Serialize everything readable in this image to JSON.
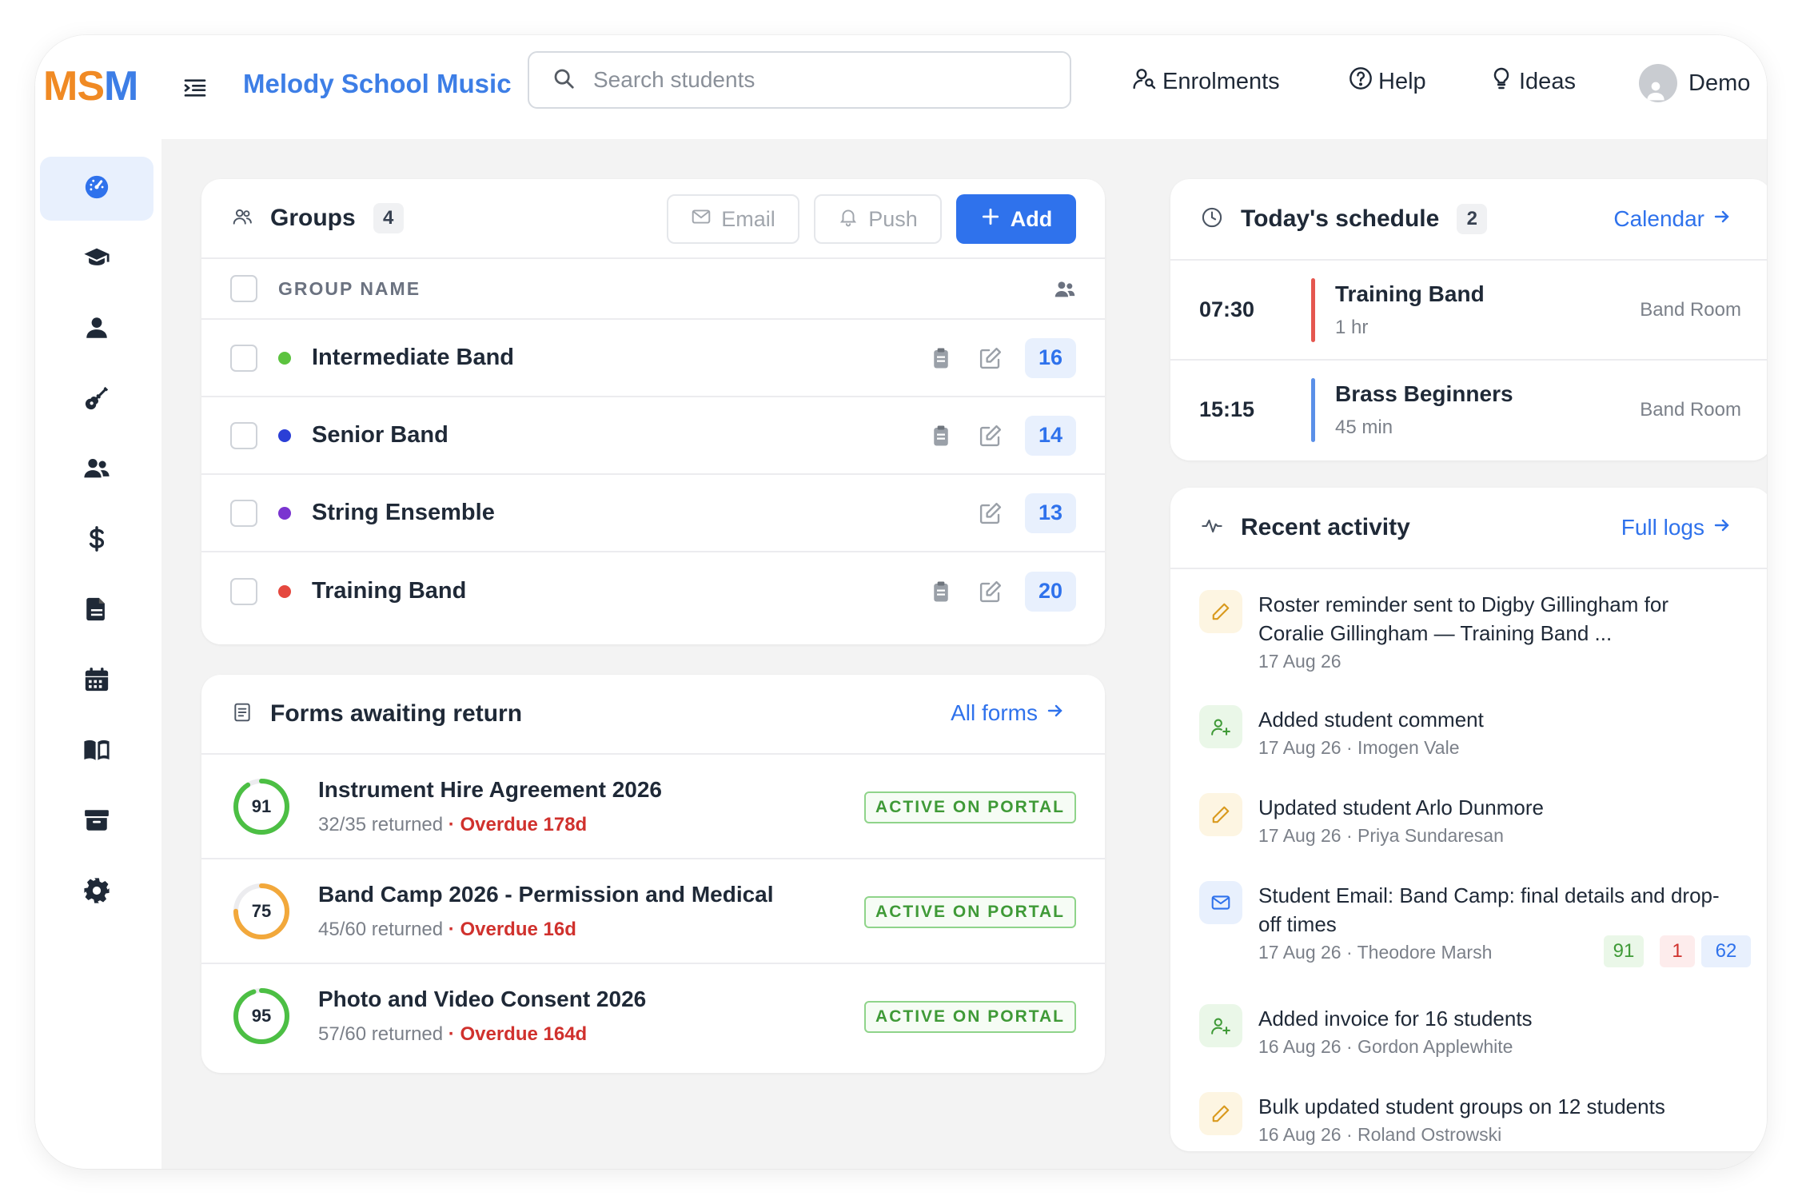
{
  "app": {
    "logo": {
      "m1": "M",
      "s": "S",
      "m2": "M"
    },
    "brand": "Melody School Music",
    "search_placeholder": "Search students",
    "nav": {
      "enrolments": "Enrolments",
      "help": "Help",
      "ideas": "Ideas",
      "user": "Demo"
    }
  },
  "sidebar": {
    "items": [
      {
        "icon": "dashboard-icon",
        "active": true
      },
      {
        "icon": "graduation-cap-icon"
      },
      {
        "icon": "user-icon"
      },
      {
        "icon": "guitar-icon"
      },
      {
        "icon": "users-icon"
      },
      {
        "icon": "dollar-icon"
      },
      {
        "icon": "file-icon"
      },
      {
        "icon": "calendar-icon"
      },
      {
        "icon": "book-icon"
      },
      {
        "icon": "archive-icon"
      },
      {
        "icon": "gear-icon"
      }
    ]
  },
  "groups": {
    "title": "Groups",
    "count": "4",
    "email_label": "Email",
    "push_label": "Push",
    "add_label": "Add",
    "column_header": "GROUP NAME",
    "rows": [
      {
        "name": "Intermediate Band",
        "color": "#5cc33f",
        "count": "16",
        "has_clipboard": true
      },
      {
        "name": "Senior Band",
        "color": "#2b3fd6",
        "count": "14",
        "has_clipboard": true
      },
      {
        "name": "String Ensemble",
        "color": "#7a34d0",
        "count": "13",
        "has_clipboard": false
      },
      {
        "name": "Training Band",
        "color": "#e5483f",
        "count": "20",
        "has_clipboard": true
      }
    ]
  },
  "forms": {
    "title": "Forms awaiting return",
    "link": "All forms",
    "rows": [
      {
        "score": "91",
        "progress": 0.91,
        "ring_color": "#4cbf44",
        "title": "Instrument Hire Agreement 2026",
        "returned": "32/35 returned",
        "overdue": "· Overdue 178d",
        "status": "ACTIVE ON PORTAL"
      },
      {
        "score": "75",
        "progress": 0.75,
        "ring_color": "#f2a83b",
        "title": "Band Camp 2026 - Permission and Medical",
        "returned": "45/60 returned",
        "overdue": "· Overdue 16d",
        "status": "ACTIVE ON PORTAL"
      },
      {
        "score": "95",
        "progress": 0.95,
        "ring_color": "#4cbf44",
        "title": "Photo and Video Consent 2026",
        "returned": "57/60 returned",
        "overdue": "· Overdue 164d",
        "status": "ACTIVE ON PORTAL"
      }
    ]
  },
  "schedule": {
    "title": "Today's schedule",
    "count": "2",
    "link": "Calendar",
    "rows": [
      {
        "time": "07:30",
        "title": "Training Band",
        "duration": "1 hr",
        "room": "Band Room",
        "bar_color": "#e5574f"
      },
      {
        "time": "15:15",
        "title": "Brass Beginners",
        "duration": "45 min",
        "room": "Band Room",
        "bar_color": "#5a90e8"
      }
    ]
  },
  "activity": {
    "title": "Recent activity",
    "link": "Full logs",
    "items": [
      {
        "icon": "pencil-icon",
        "text": "Roster reminder sent to Digby Gillingham for Coralie Gillingham — Training Band ...",
        "date": "17 Aug 26",
        "person": ""
      },
      {
        "icon": "user-plus-icon",
        "text": "Added student comment",
        "date": "17 Aug 26",
        "person": "· Imogen Vale"
      },
      {
        "icon": "pencil-icon",
        "text": "Updated student Arlo Dunmore",
        "date": "17 Aug 26",
        "person": "· Priya Sundaresan"
      },
      {
        "icon": "mail-icon",
        "text": "Student Email: Band Camp: final details and drop-off times",
        "date": "17 Aug 26",
        "person": "· Theodore Marsh",
        "stats": [
          "91",
          "1",
          "62"
        ]
      },
      {
        "icon": "user-plus-icon",
        "text": "Added invoice for 16 students",
        "date": "16 Aug 26",
        "person": "· Gordon Applewhite"
      },
      {
        "icon": "pencil-icon",
        "text": "Bulk updated student groups on 12 students",
        "date": "16 Aug 26",
        "person": "· Roland Ostrowski"
      }
    ]
  }
}
